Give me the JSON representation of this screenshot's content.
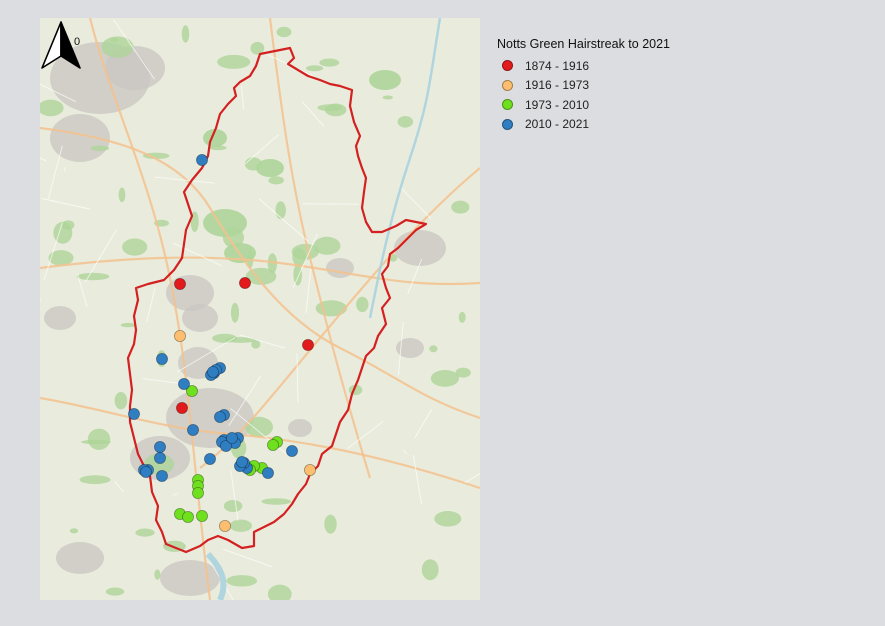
{
  "north_arrow": {
    "label": "0"
  },
  "legend": {
    "title": "Notts Green Hairstreak to 2021",
    "items": [
      {
        "key": "p1",
        "label": "1874 - 1916",
        "color": "#e31a1c"
      },
      {
        "key": "p2",
        "label": "1916 - 1973",
        "color": "#fdbf6f"
      },
      {
        "key": "p3",
        "label": "1973 - 2010",
        "color": "#6fe01e"
      },
      {
        "key": "p4",
        "label": "2010 - 2021",
        "color": "#2f7ec2"
      }
    ]
  },
  "colors": {
    "county_border": "#d42020",
    "map_background": "#e9ecdd",
    "urban": "#c9c6c1",
    "woodland": "#aed59a",
    "road": "#f3c28e",
    "water": "#aad3df"
  },
  "records": {
    "p1": [
      [
        140,
        266
      ],
      [
        205,
        265
      ],
      [
        268,
        327
      ],
      [
        142,
        390
      ]
    ],
    "p2": [
      [
        140,
        318
      ],
      [
        270,
        452
      ],
      [
        185,
        508
      ]
    ],
    "p3": [
      [
        152,
        373
      ],
      [
        237,
        424
      ],
      [
        233,
        427
      ],
      [
        222,
        450
      ],
      [
        214,
        448
      ],
      [
        210,
        452
      ],
      [
        158,
        462
      ],
      [
        158,
        468
      ],
      [
        158,
        475
      ],
      [
        140,
        496
      ],
      [
        148,
        499
      ],
      [
        162,
        498
      ]
    ],
    "p4": [
      [
        162,
        142
      ],
      [
        122,
        341
      ],
      [
        144,
        366
      ],
      [
        174,
        355
      ],
      [
        171,
        357
      ],
      [
        180,
        350
      ],
      [
        176,
        352
      ],
      [
        173,
        354
      ],
      [
        184,
        397
      ],
      [
        180,
        399
      ],
      [
        153,
        412
      ],
      [
        94,
        396
      ],
      [
        184,
        422
      ],
      [
        182,
        424
      ],
      [
        198,
        420
      ],
      [
        195,
        425
      ],
      [
        186,
        428
      ],
      [
        192,
        420
      ],
      [
        170,
        441
      ],
      [
        207,
        450
      ],
      [
        204,
        445
      ],
      [
        200,
        448
      ],
      [
        202,
        444
      ],
      [
        252,
        433
      ],
      [
        228,
        455
      ],
      [
        120,
        429
      ],
      [
        120,
        440
      ],
      [
        108,
        452
      ],
      [
        104,
        452
      ],
      [
        106,
        454
      ],
      [
        122,
        458
      ]
    ]
  }
}
